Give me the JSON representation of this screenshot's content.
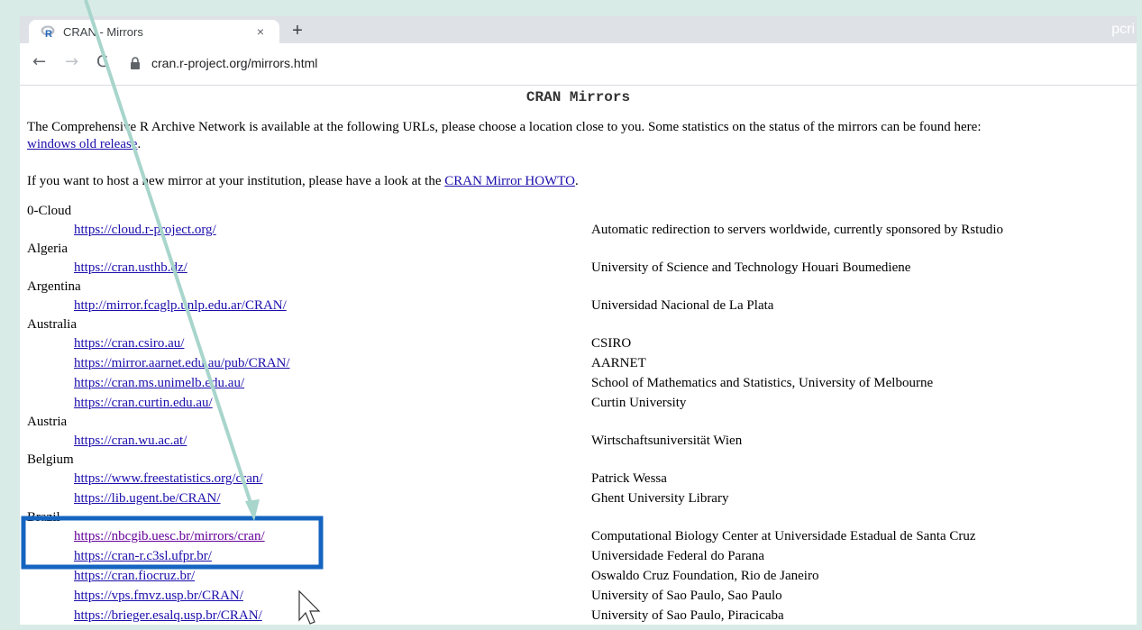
{
  "browser": {
    "tab_title": "CRAN - Mirrors",
    "tab_close": "×",
    "new_tab": "+",
    "profile_text": "pcri",
    "url": "cran.r-project.org/mirrors.html"
  },
  "page": {
    "heading": "CRAN Mirrors",
    "intro_text": "The Comprehensive R Archive Network is available at the following URLs, please choose a location close to you. Some statistics on the status of the mirrors can be found here:",
    "intro_link": "windows old release",
    "intro_end": ".",
    "howto_text": "If you want to host a new mirror at your institution, please have a look at the",
    "howto_link": "CRAN Mirror HOWTO",
    "howto_end": "."
  },
  "countries": [
    {
      "name": "0-Cloud",
      "mirrors": [
        {
          "url": "https://cloud.r-project.org/",
          "desc": "Automatic redirection to servers worldwide, currently sponsored by Rstudio"
        }
      ]
    },
    {
      "name": "Algeria",
      "mirrors": [
        {
          "url": "https://cran.usthb.dz/",
          "desc": "University of Science and Technology Houari Boumediene"
        }
      ]
    },
    {
      "name": "Argentina",
      "mirrors": [
        {
          "url": "http://mirror.fcaglp.unlp.edu.ar/CRAN/",
          "desc": "Universidad Nacional de La Plata"
        }
      ]
    },
    {
      "name": "Australia",
      "mirrors": [
        {
          "url": "https://cran.csiro.au/",
          "desc": "CSIRO"
        },
        {
          "url": "https://mirror.aarnet.edu.au/pub/CRAN/",
          "desc": "AARNET"
        },
        {
          "url": "https://cran.ms.unimelb.edu.au/",
          "desc": "School of Mathematics and Statistics, University of Melbourne"
        },
        {
          "url": "https://cran.curtin.edu.au/",
          "desc": "Curtin University"
        }
      ]
    },
    {
      "name": "Austria",
      "mirrors": [
        {
          "url": "https://cran.wu.ac.at/",
          "desc": "Wirtschaftsuniversität Wien"
        }
      ]
    },
    {
      "name": "Belgium",
      "mirrors": [
        {
          "url": "https://www.freestatistics.org/cran/",
          "desc": "Patrick Wessa"
        },
        {
          "url": "https://lib.ugent.be/CRAN/",
          "desc": "Ghent University Library"
        }
      ]
    },
    {
      "name": "Brazil",
      "mirrors": [
        {
          "url": "https://nbcgib.uesc.br/mirrors/cran/",
          "desc": "Computational Biology Center at Universidade Estadual de Santa Cruz",
          "visited": true
        },
        {
          "url": "https://cran-r.c3sl.ufpr.br/",
          "desc": "Universidade Federal do Parana"
        },
        {
          "url": "https://cran.fiocruz.br/",
          "desc": "Oswaldo Cruz Foundation, Rio de Janeiro"
        },
        {
          "url": "https://vps.fmvz.usp.br/CRAN/",
          "desc": "University of Sao Paulo, Sao Paulo"
        },
        {
          "url": "https://brieger.esalq.usp.br/CRAN/",
          "desc": "University of Sao Paulo, Piracicaba"
        }
      ]
    }
  ],
  "annotation": {
    "highlight_color": "#1565c0",
    "arrow_color": "#a8d5cc"
  }
}
